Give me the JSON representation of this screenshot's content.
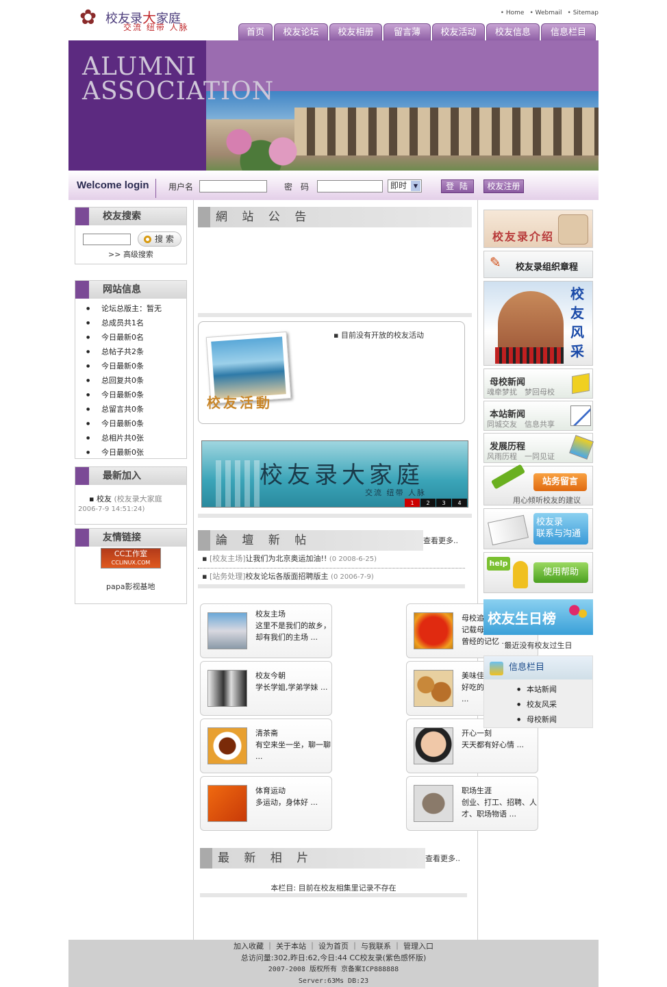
{
  "header": {
    "logo_main_a": "校友录",
    "logo_main_b": "大",
    "logo_main_c": "家庭",
    "logo_sub": "交流 纽带 人脉",
    "top_links": [
      "Home",
      "Webmail",
      "Sitemap"
    ],
    "nav": [
      "首页",
      "校友论坛",
      "校友相册",
      "留言薄",
      "校友活动",
      "校友信息",
      "信息栏目"
    ]
  },
  "banner": {
    "line1": "ALUMNI",
    "line2": "ASSOCIATION"
  },
  "login": {
    "welcome": "Welcome login",
    "user_label": "用户名",
    "pass_label": "密　码",
    "mode_value": "即时",
    "login_btn": "登 陆",
    "register_btn": "校友注册"
  },
  "left": {
    "search_title": "校友搜索",
    "search_btn": "搜 索",
    "advanced": "高级搜索",
    "info_title": "网站信息",
    "info_items": [
      "论坛总版主：暂无",
      "总成员共1名",
      "今日最新0名",
      "总帖子共2条",
      "今日最新0条",
      "总回复共0条",
      "今日最新0条",
      "总留言共0条",
      "今日最新0条",
      "总相片共0张",
      "今日最新0张"
    ],
    "newest_title": "最新加入",
    "newest_name": "校友",
    "newest_detail": "(校友录大家庭",
    "newest_time": "2006-7-9 14:51:24)",
    "links_title": "友情链接",
    "link_logo_text": "CC工作室",
    "link_logo_sub": "CCLINUX.COM",
    "link_papa": "papa影视基地"
  },
  "center": {
    "notice_title": "網 站 公 告",
    "activity_empty": "目前没有开放的校友活动",
    "activity_label": "校友活動",
    "promo_title": "校友录大家庭",
    "promo_sub": "交流  纽带  人脉",
    "promo_pages": [
      "1",
      "2",
      "3",
      "4"
    ],
    "forum_title": "論 壇 新 帖",
    "forum_more": "查看更多..",
    "forum_posts": [
      {
        "board": "[校友主场]",
        "title": "让我们为北京奥运加油!!",
        "meta": "(0 2008-6-25)"
      },
      {
        "board": "[站务处理]",
        "title": "校友论坛各版面招聘版主",
        "meta": "(0 2006-7-9)"
      }
    ],
    "cards": [
      {
        "title": "校友主场",
        "desc": "这里不是我们的故乡，却有我们的主场 ..."
      },
      {
        "title": "母校追忆",
        "desc": "记载母校的往事，唤起曾经的记忆 ..."
      },
      {
        "title": "校友今朝",
        "desc": "学长学姐,学弟学妹 ..."
      },
      {
        "title": "美味佳肴",
        "desc": "好吃的地方都介绍来 ..."
      },
      {
        "title": "清茶斋",
        "desc": "有空来坐一坐，聊一聊 ..."
      },
      {
        "title": "开心一刻",
        "desc": "天天都有好心情 ..."
      },
      {
        "title": "体育运动",
        "desc": "多运动，身体好 ..."
      },
      {
        "title": "职场生涯",
        "desc": "创业、打工、招聘、人才、职场物语 ..."
      }
    ],
    "photo_title": "最 新 相 片",
    "photo_more": "查看更多..",
    "photo_empty": "本栏目: 目前在校友相集里记录不存在"
  },
  "right": {
    "intro": "校友录介绍",
    "charter": "校友录组织章程",
    "style_v": [
      "校",
      "友",
      "风",
      "采"
    ],
    "news1_title": "母校新闻",
    "news1_sub": "魂牵梦扰　梦回母校",
    "news2_title": "本站新闻",
    "news2_sub": "同城交友　信息共享",
    "news3_title": "发展历程",
    "news3_sub": "风雨历程　一同见证",
    "msg_btn": "站务留言",
    "msg_sub": "用心倾听校友的建议",
    "contact_a": "校友录",
    "contact_b": "联系与沟通",
    "help_tag": "help",
    "help_btn": "使用帮助",
    "birthday_title": "校友生日榜",
    "birthday_empty": "最近没有校友过生日",
    "info_title": "信息栏目",
    "info_items": [
      "本站新闻",
      "校友风采",
      "母校新闻"
    ]
  },
  "footer": {
    "links": "加入收藏 ｜ 关于本站 ｜ 设为首页 ｜ 与我联系 ｜ 管理入口",
    "stats": "总访问量:302,昨日:62,今日:44 CC校友录(紫色感怀版)",
    "copyright": "2007-2008 版权所有 京备案ICP888888",
    "server": "Server:63Ms  DB:23"
  },
  "colors": {
    "brand_purple": "#5c2a80",
    "nav_purple": "#8f5fa5",
    "accent_red": "#c0282b"
  }
}
